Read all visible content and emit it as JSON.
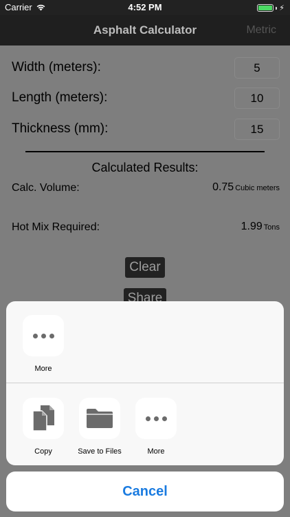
{
  "status": {
    "carrier": "Carrier",
    "time": "4:52 PM",
    "battery_level": 1.0
  },
  "nav": {
    "title": "Asphalt Calculator",
    "right_button": "Metric"
  },
  "form": {
    "width_label": "Width (meters):",
    "width_value": "5",
    "length_label": "Length (meters):",
    "length_value": "10",
    "thickness_label": "Thickness (mm):",
    "thickness_value": "15"
  },
  "results": {
    "title": "Calculated Results:",
    "volume_label": "Calc. Volume:",
    "volume_value": "0.75",
    "volume_unit": "Cubic meters",
    "hotmix_label": "Hot Mix Required:",
    "hotmix_value": "1.99",
    "hotmix_unit": "Tons"
  },
  "buttons": {
    "clear": "Clear",
    "share": "Share"
  },
  "share_sheet": {
    "top_row": [
      {
        "label": "More",
        "icon": "more-icon"
      }
    ],
    "bottom_row": [
      {
        "label": "Copy",
        "icon": "copy-icon"
      },
      {
        "label": "Save to Files",
        "icon": "folder-icon"
      },
      {
        "label": "More",
        "icon": "more-icon"
      }
    ],
    "cancel": "Cancel"
  },
  "colors": {
    "accent": "#1a7be0",
    "battery": "#4cd964",
    "dim_overlay": "#7e7e7e"
  }
}
